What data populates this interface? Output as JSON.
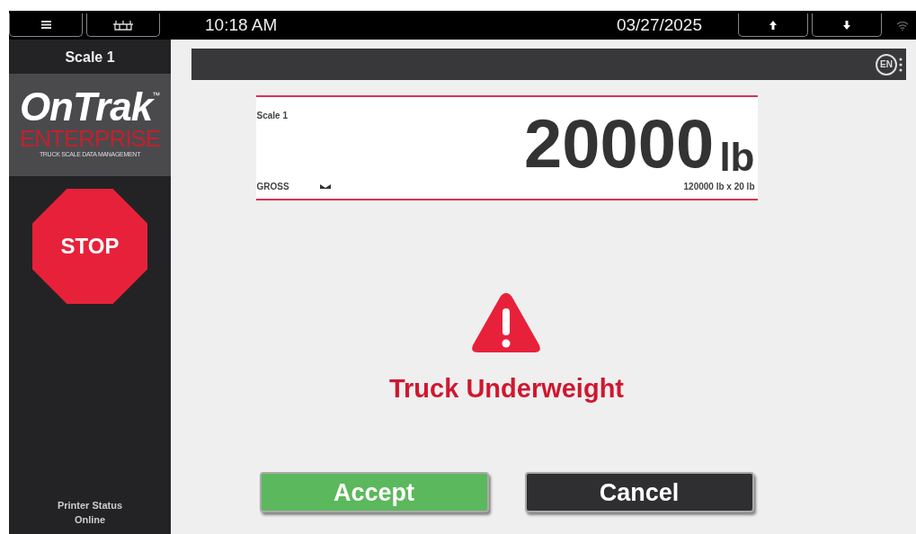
{
  "top_bar": {
    "time": "10:18 AM",
    "date": "03/27/2025"
  },
  "sidebar": {
    "scale_name": "Scale 1",
    "logo": {
      "name": "OnTrak",
      "trademark": "™",
      "edition": "ENTERPRISE",
      "tagline": "TRUCK SCALE DATA MANAGEMENT"
    },
    "stop_button": "STOP",
    "printer_status": {
      "label": "Printer Status",
      "value": "Online"
    }
  },
  "header_bar": {
    "language": "EN"
  },
  "scale_display": {
    "name": "Scale 1",
    "weight": "20000",
    "unit": "lb",
    "mode": "GROSS",
    "capacity": "120000 lb x 20 lb"
  },
  "alert": {
    "message": "Truck Underweight"
  },
  "buttons": [
    {
      "label": "Accept",
      "kind": "primary"
    },
    {
      "label": "Cancel",
      "kind": "secondary"
    }
  ]
}
